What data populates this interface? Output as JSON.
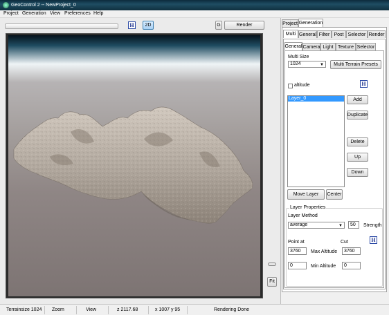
{
  "window": {
    "title": "GeoControl 2  --  NewProject_0"
  },
  "menu": [
    "Project",
    "Generation",
    "View",
    "Preferences",
    "Help"
  ],
  "toolbar": {
    "h_label": "H",
    "mode_2d": "2D",
    "g_label": "G",
    "render_label": "Render"
  },
  "viewport": {
    "fit_label": "Fit"
  },
  "status": {
    "terrainsize": "Terrainsize 1024",
    "zoom": "Zoom",
    "view": "View",
    "z": "z 2117.68",
    "coords": "x 1007 y 95",
    "message": "Rendering Done"
  },
  "tabs_top": [
    "Project",
    "Generation"
  ],
  "tabs_second": [
    "Multi",
    "General",
    "Filter",
    "Post",
    "Selector",
    "Render"
  ],
  "tabs_third": [
    "General",
    "Camera",
    "Light",
    "Texture",
    "Selector"
  ],
  "multi": {
    "size_label": "Multi Size",
    "size_value": "1024",
    "presets_label": "Multi Terrain Presets",
    "altitude_label": "altitude",
    "h_label": "H",
    "layers": [
      "Layer_0"
    ],
    "add": "Add",
    "duplicate": "Duplicate",
    "delete": "Delete",
    "up": "Up",
    "down": "Down",
    "move_layer": "Move Layer",
    "center": "Center"
  },
  "layer_props": {
    "title": "Layer Properties",
    "method_label": "Layer Method",
    "method_value": "average",
    "strength_value": "50",
    "strength_label": "Strength",
    "point_at_label": "Point at",
    "cut_label": "Cut",
    "h_label": "H",
    "max_alt_left": "3760",
    "max_alt_label": "Max Altitude",
    "max_alt_right": "3760",
    "min_alt_left": "0",
    "min_alt_label": "Min Altitude",
    "min_alt_right": "0"
  },
  "colors": {
    "selection": "#3399ff",
    "titlebar": "#1f4d63",
    "terrain": "#c0b7ad"
  }
}
